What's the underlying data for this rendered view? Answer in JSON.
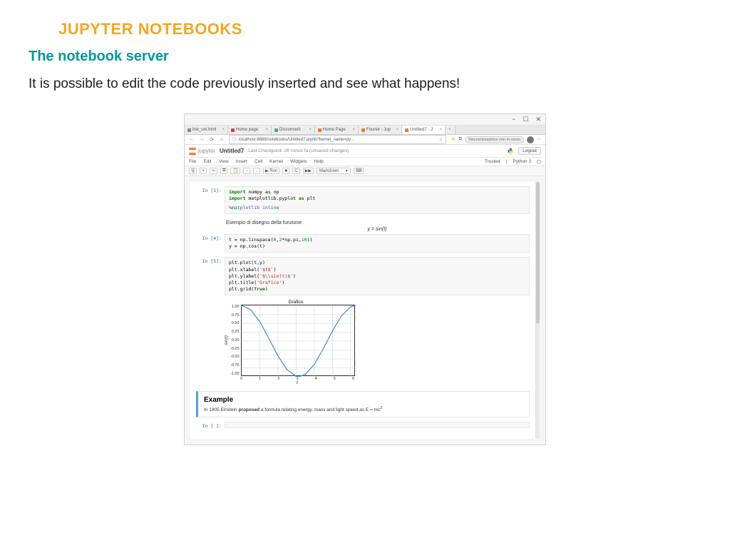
{
  "slide": {
    "title": "JUPYTER NOTEBOOKS",
    "subheading": "The notebook server",
    "body": "It is possible to edit the code previously inserted and see what happens!"
  },
  "browser": {
    "window_controls": {
      "min": "−",
      "max": "☐",
      "close": "✕"
    },
    "tabs": [
      {
        "label": "link_uni.html",
        "icon_color": "#888"
      },
      {
        "label": "Home page",
        "icon_color": "#dc3e2a"
      },
      {
        "label": "Disconnetti",
        "icon_color": "#4a8"
      },
      {
        "label": "Home Page",
        "icon_color": "#f37726"
      },
      {
        "label": "Fourier - Jup",
        "icon_color": "#f37726"
      },
      {
        "label": "Untitled7 - J",
        "icon_color": "#f37726",
        "active": true
      }
    ],
    "new_tab": "+",
    "nav": {
      "back": "←",
      "fwd": "→",
      "reload": "⟳",
      "home": "⌂"
    },
    "url_prefix": "ⓘ",
    "url": "localhost:8888/notebooks/Untitled7.ipynb?kernel_name=py…",
    "url_icons": {
      "star": "☆",
      "bookmark": "⚡",
      "reader": "⧉"
    },
    "sync": "Sincronizzazione non in corso",
    "more": "⋯"
  },
  "notebook": {
    "logo_text": "jupyter",
    "title": "Untitled7",
    "checkpoint": "Last Checkpoint: 28 minuti fa  (unsaved changes)",
    "logout": "Logout",
    "menu": [
      "File",
      "Edit",
      "View",
      "Insert",
      "Cell",
      "Kernel",
      "Widgets",
      "Help"
    ],
    "trusted": "Trusted",
    "kernel": "Python 3",
    "toolbar": {
      "save": "🖫",
      "add": "+",
      "cut": "✂",
      "copy": "⧉",
      "paste": "📋",
      "up": "↑",
      "down": "↓",
      "run": "▶ Run",
      "stop": "■",
      "restart": "C",
      "ff": "▶▶",
      "celltype": "Markdown",
      "keyboard": "⌨"
    },
    "cells": {
      "c1_prompt": "In [1]:",
      "c1_l1a": "import",
      "c1_l1b": " numpy ",
      "c1_l1c": "as",
      "c1_l1d": " np",
      "c1_l2a": "import",
      "c1_l2b": " matplotlib.pyplot ",
      "c1_l2c": "as",
      "c1_l2d": " plt",
      "c1_l3": "%matplotlib inline",
      "md1_text": "Esempio di disegno della funzione",
      "md1_eq": "y = sin(t)",
      "c4_prompt": "In [4]:",
      "c4_l1a": "t = np.linspace(",
      "c4_l1b": "0",
      "c4_l1c": ",",
      "c4_l1d": "2",
      "c4_l1e": "*np.pi,",
      "c4_l1f": "101",
      "c4_l1g": ")",
      "c4_l2": "y = np.cos(t)",
      "c5_prompt": "In [5]:",
      "c5_l1": "plt.plot(t,y)",
      "c5_l2a": "plt.xlabel(",
      "c5_l2b": "'$t$'",
      "c5_l2c": ")",
      "c5_l3a": "plt.ylabel(",
      "c5_l3b": "'$\\\\sin(t)$'",
      "c5_l3c": ")",
      "c5_l4a": "plt.title(",
      "c5_l4b": "'Grafico'",
      "c5_l4c": ")",
      "c5_l5a": "plt.grid(",
      "c5_l5b": "True",
      "c5_l5c": ")",
      "empty_prompt": "In [ ]:",
      "md2_heading": "Example",
      "md2_body_a": "In 1905 Einstein ",
      "md2_body_b": "proposed",
      "md2_body_c": " a formula relating energy, mass and light speed as E = mc",
      "md2_body_sup": "2"
    }
  },
  "chart_data": {
    "type": "line",
    "title": "Grafico",
    "xlabel": "t",
    "ylabel": "sin(t)",
    "xlim": [
      0,
      6.283
    ],
    "ylim": [
      -1.0,
      1.0
    ],
    "xticks": [
      0,
      1,
      2,
      3,
      4,
      5,
      6
    ],
    "yticks": [
      1.0,
      0.75,
      0.5,
      0.25,
      0.0,
      -0.25,
      -0.5,
      -0.75,
      -1.0
    ],
    "series": [
      {
        "name": "cos(t)",
        "x": [
          0,
          0.5,
          1,
          1.5,
          2,
          2.5,
          3,
          3.14159,
          3.5,
          4,
          4.5,
          5,
          5.5,
          6,
          6.2832
        ],
        "y": [
          1,
          0.8776,
          0.5403,
          0.0707,
          -0.4161,
          -0.8011,
          -0.99,
          -1,
          -0.9365,
          -0.6536,
          -0.2108,
          0.2837,
          0.7087,
          0.9602,
          1
        ]
      }
    ]
  }
}
